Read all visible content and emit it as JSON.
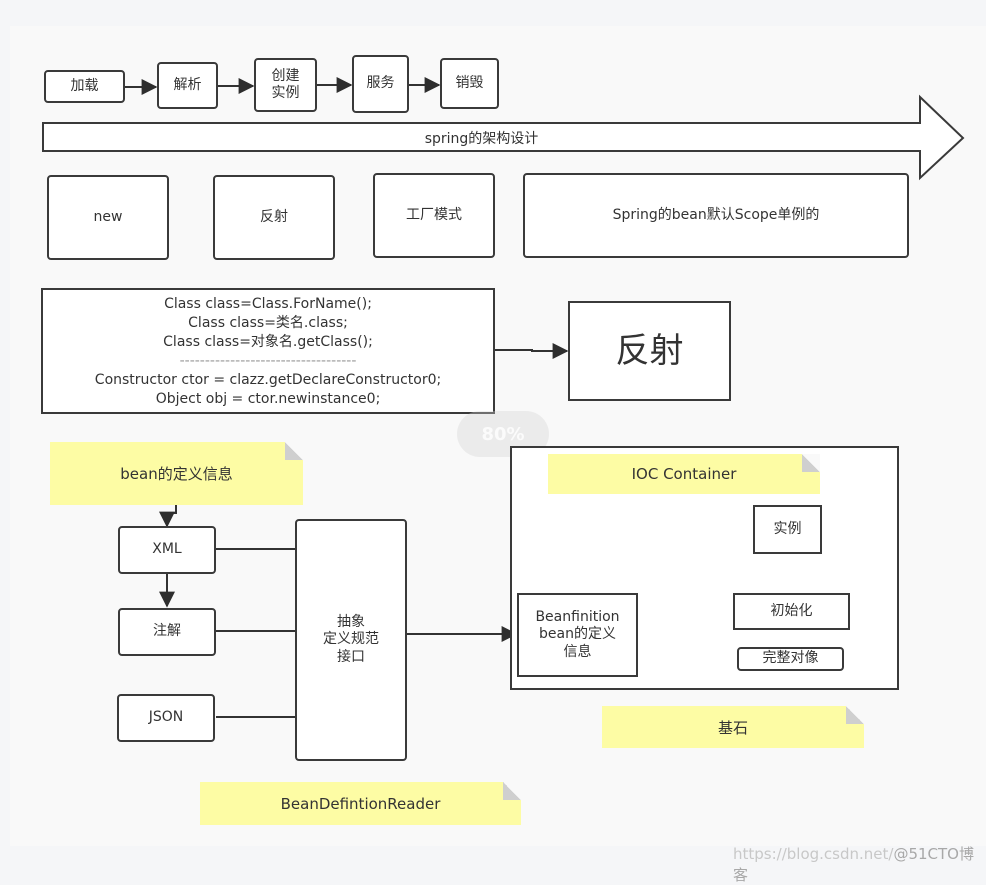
{
  "lifecycle": {
    "steps": [
      "加载",
      "解析",
      "创建\n实例",
      "服务",
      "销毁"
    ]
  },
  "architecture_arrow": {
    "label": "spring的架构设计"
  },
  "creation_methods": {
    "items": [
      "new",
      "反射",
      "工厂模式",
      "Spring的bean默认Scope单例的"
    ]
  },
  "reflection_code": {
    "lines": [
      "Class class=Class.ForName();",
      "Class class=类名.class;",
      "Class class=对象名.getClass();",
      "-----------------------------------",
      "Constructor ctor = clazz.getDeclareConstructor0;",
      "Object obj = ctor.newinstance0;"
    ],
    "target_label": "反射"
  },
  "zoom_badge": "80%",
  "bean_definition": {
    "note": "bean的定义信息",
    "sources": [
      "XML",
      "注解",
      "JSON"
    ],
    "interface_label": "抽象\n定义规范\n接口",
    "reader_note": "BeanDefintionReader"
  },
  "ioc_container": {
    "note": "IOC Container",
    "definition_box": "Beanfinition\nbean的定义\n信息",
    "instance": "实例",
    "init": "初始化",
    "complete": "完整对像",
    "foundation_note": "基石"
  },
  "watermark": {
    "url": "https://blog.csdn.net/",
    "site": "@51CTO博客"
  }
}
